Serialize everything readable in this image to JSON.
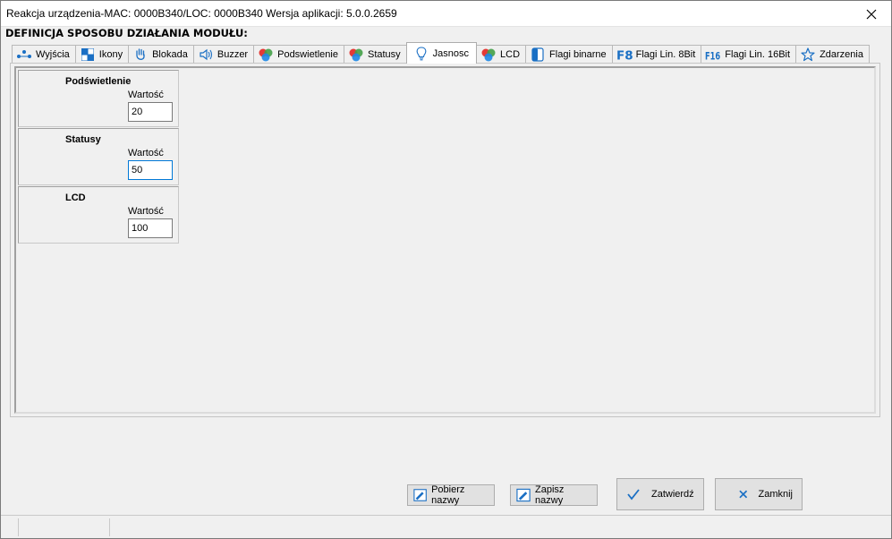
{
  "window": {
    "title": "Reakcja urządzenia-MAC: 0000B340/LOC: 0000B340 Wersja aplikacji: 5.0.0.2659"
  },
  "section_title": "DEFINICJA SPOSOBU DZIAŁANIA MODUŁU:",
  "tabs": [
    {
      "label": "Wyjścia",
      "icon": "outputs-icon"
    },
    {
      "label": "Ikony",
      "icon": "icons-icon"
    },
    {
      "label": "Blokada",
      "icon": "hand-icon"
    },
    {
      "label": "Buzzer",
      "icon": "speaker-icon"
    },
    {
      "label": "Podswietlenie",
      "icon": "rgb-icon"
    },
    {
      "label": "Statusy",
      "icon": "rgb-icon"
    },
    {
      "label": "Jasnosc",
      "icon": "bulb-icon",
      "active": true
    },
    {
      "label": "LCD",
      "icon": "rgb-icon"
    },
    {
      "label": "Flagi binarne",
      "icon": "flag-icon"
    },
    {
      "label": "Flagi Lin. 8Bit",
      "icon": "f8-icon"
    },
    {
      "label": "Flagi Lin. 16Bit",
      "icon": "f16-icon"
    },
    {
      "label": "Zdarzenia",
      "icon": "star-icon"
    }
  ],
  "groups": [
    {
      "title": "Podświetlenie",
      "label": "Wartość",
      "value": "20"
    },
    {
      "title": "Statusy",
      "label": "Wartość",
      "value": "50"
    },
    {
      "title": "LCD",
      "label": "Wartość",
      "value": "100"
    }
  ],
  "buttons": {
    "fetch_names": "Pobierz nazwy",
    "save_names": "Zapisz nazwy",
    "confirm": "Zatwierdź",
    "close": "Zamknij"
  },
  "colors": {
    "accent": "#0078d7",
    "check": "#1a6fc4",
    "close_x": "#1a6fc4"
  }
}
